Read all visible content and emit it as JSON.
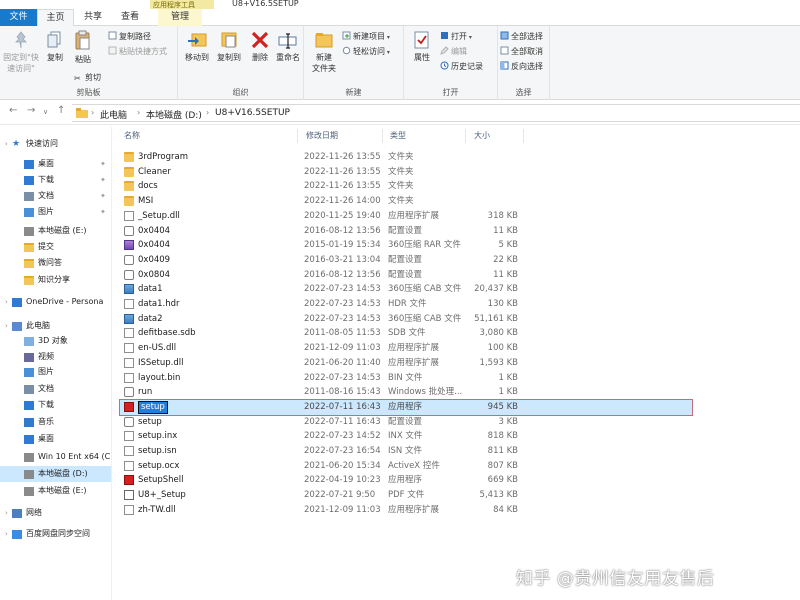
{
  "window": {
    "title": "U8+V16.5SETUP",
    "context_title": "应用程序工具"
  },
  "tabs": {
    "file": "文件",
    "home": "主页",
    "share": "共享",
    "view": "查看",
    "manage": "管理"
  },
  "ribbon": {
    "clipboard": {
      "group_label": "剪贴板",
      "pin_quick_access": "固定到\"快速访问\"",
      "copy": "复制",
      "paste": "粘贴",
      "copy_path": "复制路径",
      "paste_shortcut": "粘贴快捷方式",
      "cut": "剪切"
    },
    "organize": {
      "group_label": "组织",
      "move_to": "移动到",
      "copy_to": "复制到",
      "delete": "删除",
      "rename": "重命名"
    },
    "new": {
      "group_label": "新建",
      "new_folder": "新建\n文件夹",
      "new_item": "新建项目",
      "easy_access": "轻松访问"
    },
    "open": {
      "group_label": "打开",
      "properties": "属性",
      "open": "打开",
      "edit": "编辑",
      "history": "历史记录"
    },
    "select": {
      "group_label": "选择",
      "select_all": "全部选择",
      "select_none": "全部取消",
      "invert": "反向选择"
    }
  },
  "address": {
    "crumbs": [
      "此电脑",
      "本地磁盘 (D:)",
      "U8+V16.5SETUP"
    ]
  },
  "nav": {
    "items": [
      {
        "label": "快速访问",
        "icon": "star-icon",
        "level": 0
      },
      {
        "label": "桌面",
        "icon": "desktop-icon",
        "level": 1,
        "pinned": true
      },
      {
        "label": "下载",
        "icon": "download-icon",
        "level": 1,
        "pinned": true
      },
      {
        "label": "文档",
        "icon": "document-icon",
        "level": 1,
        "pinned": true
      },
      {
        "label": "图片",
        "icon": "picture-icon",
        "level": 1,
        "pinned": true
      },
      {
        "label": "本地磁盘 (E:)",
        "icon": "drive-icon",
        "level": 1
      },
      {
        "label": "提交",
        "icon": "folder-icon",
        "level": 1
      },
      {
        "label": "微问答",
        "icon": "folder-icon",
        "level": 1
      },
      {
        "label": "知识分享",
        "icon": "folder-icon",
        "level": 1
      },
      {
        "label": "OneDrive - Persona",
        "icon": "cloud-icon",
        "level": 0
      },
      {
        "label": "此电脑",
        "icon": "computer-icon",
        "level": 0
      },
      {
        "label": "3D 对象",
        "icon": "3d-objects-icon",
        "level": 1
      },
      {
        "label": "视频",
        "icon": "video-icon",
        "level": 1
      },
      {
        "label": "图片",
        "icon": "picture-icon",
        "level": 1
      },
      {
        "label": "文档",
        "icon": "document-icon",
        "level": 1
      },
      {
        "label": "下载",
        "icon": "download-icon",
        "level": 1
      },
      {
        "label": "音乐",
        "icon": "music-icon",
        "level": 1
      },
      {
        "label": "桌面",
        "icon": "desktop-icon",
        "level": 1
      },
      {
        "label": "Win 10 Ent x64 (C",
        "icon": "drive-icon",
        "level": 1
      },
      {
        "label": "本地磁盘 (D:)",
        "icon": "drive-icon",
        "level": 1,
        "selected": true
      },
      {
        "label": "本地磁盘 (E:)",
        "icon": "drive-icon",
        "level": 1
      },
      {
        "label": "网络",
        "icon": "network-icon",
        "level": 0
      },
      {
        "label": "百度网盘同步空间",
        "icon": "baidu-netdisk-icon",
        "level": 0
      }
    ]
  },
  "columns": {
    "name": "名称",
    "date": "修改日期",
    "type": "类型",
    "size": "大小"
  },
  "files": [
    {
      "name": "3rdProgram",
      "date": "2022-11-26 13:55",
      "type": "文件夹",
      "size": "",
      "icon": "folder"
    },
    {
      "name": "Cleaner",
      "date": "2022-11-26 13:55",
      "type": "文件夹",
      "size": "",
      "icon": "folder"
    },
    {
      "name": "docs",
      "date": "2022-11-26 13:55",
      "type": "文件夹",
      "size": "",
      "icon": "folder"
    },
    {
      "name": "MSI",
      "date": "2022-11-26 14:00",
      "type": "文件夹",
      "size": "",
      "icon": "folder"
    },
    {
      "name": "_Setup.dll",
      "date": "2020-11-25 19:40",
      "type": "应用程序扩展",
      "size": "318 KB",
      "icon": "doc"
    },
    {
      "name": "0x0404",
      "date": "2016-08-12 13:56",
      "type": "配置设置",
      "size": "11 KB",
      "icon": "cfg"
    },
    {
      "name": "0x0404",
      "date": "2015-01-19 15:34",
      "type": "360压缩 RAR 文件",
      "size": "5 KB",
      "icon": "rar"
    },
    {
      "name": "0x0409",
      "date": "2016-03-21 13:04",
      "type": "配置设置",
      "size": "22 KB",
      "icon": "cfg"
    },
    {
      "name": "0x0804",
      "date": "2016-08-12 13:56",
      "type": "配置设置",
      "size": "11 KB",
      "icon": "cfg"
    },
    {
      "name": "data1",
      "date": "2022-07-23 14:53",
      "type": "360压缩 CAB 文件",
      "size": "20,437 KB",
      "icon": "cab"
    },
    {
      "name": "data1.hdr",
      "date": "2022-07-23 14:53",
      "type": "HDR 文件",
      "size": "130 KB",
      "icon": "doc"
    },
    {
      "name": "data2",
      "date": "2022-07-23 14:53",
      "type": "360压缩 CAB 文件",
      "size": "51,161 KB",
      "icon": "cab"
    },
    {
      "name": "defitbase.sdb",
      "date": "2011-08-05 11:53",
      "type": "SDB 文件",
      "size": "3,080 KB",
      "icon": "doc"
    },
    {
      "name": "en-US.dll",
      "date": "2021-12-09 11:03",
      "type": "应用程序扩展",
      "size": "100 KB",
      "icon": "doc"
    },
    {
      "name": "ISSetup.dll",
      "date": "2021-06-20 11:40",
      "type": "应用程序扩展",
      "size": "1,593 KB",
      "icon": "doc"
    },
    {
      "name": "layout.bin",
      "date": "2022-07-23 14:53",
      "type": "BIN 文件",
      "size": "1 KB",
      "icon": "doc"
    },
    {
      "name": "run",
      "date": "2011-08-16 15:43",
      "type": "Windows 批处理...",
      "size": "1 KB",
      "icon": "cfg"
    },
    {
      "name": "setup",
      "date": "2022-07-11 16:43",
      "type": "应用程序",
      "size": "945 KB",
      "icon": "redapp",
      "selected": true
    },
    {
      "name": "setup",
      "date": "2022-07-11 16:43",
      "type": "配置设置",
      "size": "3 KB",
      "icon": "cfg"
    },
    {
      "name": "setup.inx",
      "date": "2022-07-23 14:52",
      "type": "INX 文件",
      "size": "818 KB",
      "icon": "doc"
    },
    {
      "name": "setup.isn",
      "date": "2022-07-23 16:54",
      "type": "ISN 文件",
      "size": "811 KB",
      "icon": "doc"
    },
    {
      "name": "setup.ocx",
      "date": "2021-06-20 15:34",
      "type": "ActiveX 控件",
      "size": "807 KB",
      "icon": "doc"
    },
    {
      "name": "SetupShell",
      "date": "2022-04-19 10:23",
      "type": "应用程序",
      "size": "669 KB",
      "icon": "redapp"
    },
    {
      "name": "U8+_Setup",
      "date": "2022-07-21 9:50",
      "type": "PDF 文件",
      "size": "5,413 KB",
      "icon": "pdf"
    },
    {
      "name": "zh-TW.dll",
      "date": "2021-12-09 11:03",
      "type": "应用程序扩展",
      "size": "84 KB",
      "icon": "doc"
    }
  ],
  "watermark": "知乎 @贵州信友用友售后"
}
